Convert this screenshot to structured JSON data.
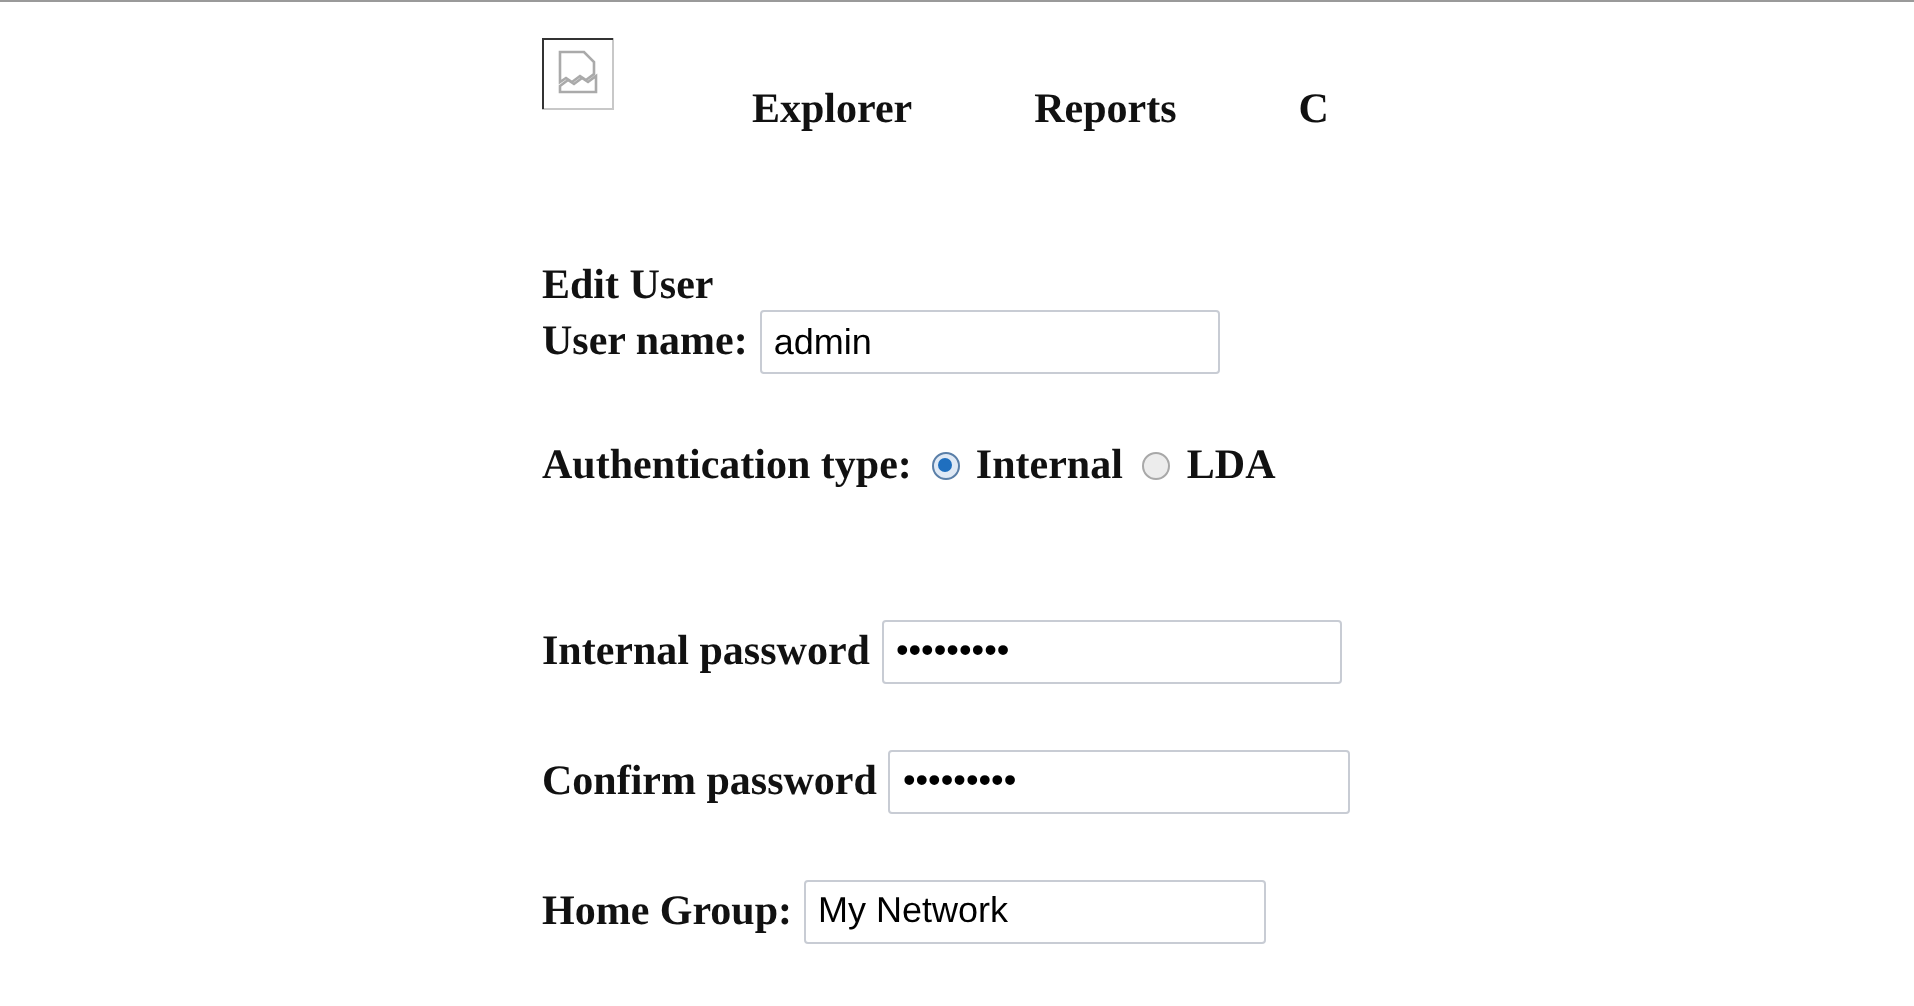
{
  "nav": [
    {
      "label": "Explorer"
    },
    {
      "label": "Reports"
    },
    {
      "label": "C"
    }
  ],
  "form": {
    "title": "Edit User",
    "user_name": {
      "label": "User name:",
      "value": "admin"
    },
    "auth": {
      "label": "Authentication type:",
      "options": [
        {
          "label": "Internal",
          "selected": true
        },
        {
          "label": "LDA",
          "selected": false
        }
      ]
    },
    "internal_password": {
      "label": "Internal password",
      "value": "•••••••••"
    },
    "confirm_password": {
      "label": "Confirm password",
      "value": "•••••••••"
    },
    "home_group": {
      "label": "Home Group:",
      "value": "My Network"
    }
  }
}
